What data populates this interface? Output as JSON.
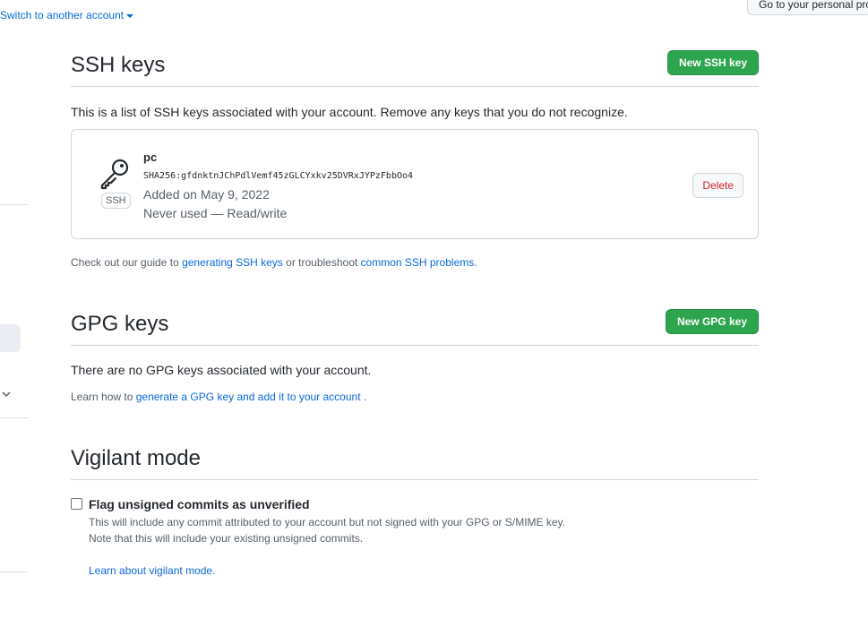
{
  "header": {
    "switch_account": "Switch to another account",
    "personal_profile": "Go to your personal profile"
  },
  "ssh": {
    "title": "SSH keys",
    "new_button": "New SSH key",
    "description": "This is a list of SSH keys associated with your account. Remove any keys that you do not recognize.",
    "keys": [
      {
        "name": "pc",
        "badge": "SSH",
        "fingerprint": "SHA256:gfdnktnJChPdlVemf45zGLCYxkv25DVRxJYPzFbbOo4",
        "added": "Added on May 9, 2022",
        "usage": "Never used — Read/write",
        "delete_label": "Delete"
      }
    ],
    "guide": {
      "prefix": "Check out our guide to ",
      "link1": "generating SSH keys",
      "middle": " or troubleshoot ",
      "link2": "common SSH problems",
      "suffix": "."
    }
  },
  "gpg": {
    "title": "GPG keys",
    "new_button": "New GPG key",
    "empty": "There are no GPG keys associated with your account.",
    "learn": {
      "prefix": "Learn how to ",
      "link": "generate a GPG key and add it to your account",
      "suffix": " ."
    }
  },
  "vigilant": {
    "title": "Vigilant mode",
    "checkbox_label": "Flag unsigned commits as unverified",
    "checked": false,
    "note1": "This will include any commit attributed to your account but not signed with your GPG or S/MIME key.",
    "note2": "Note that this will include your existing unsigned commits.",
    "learn_link": "Learn about vigilant mode."
  }
}
